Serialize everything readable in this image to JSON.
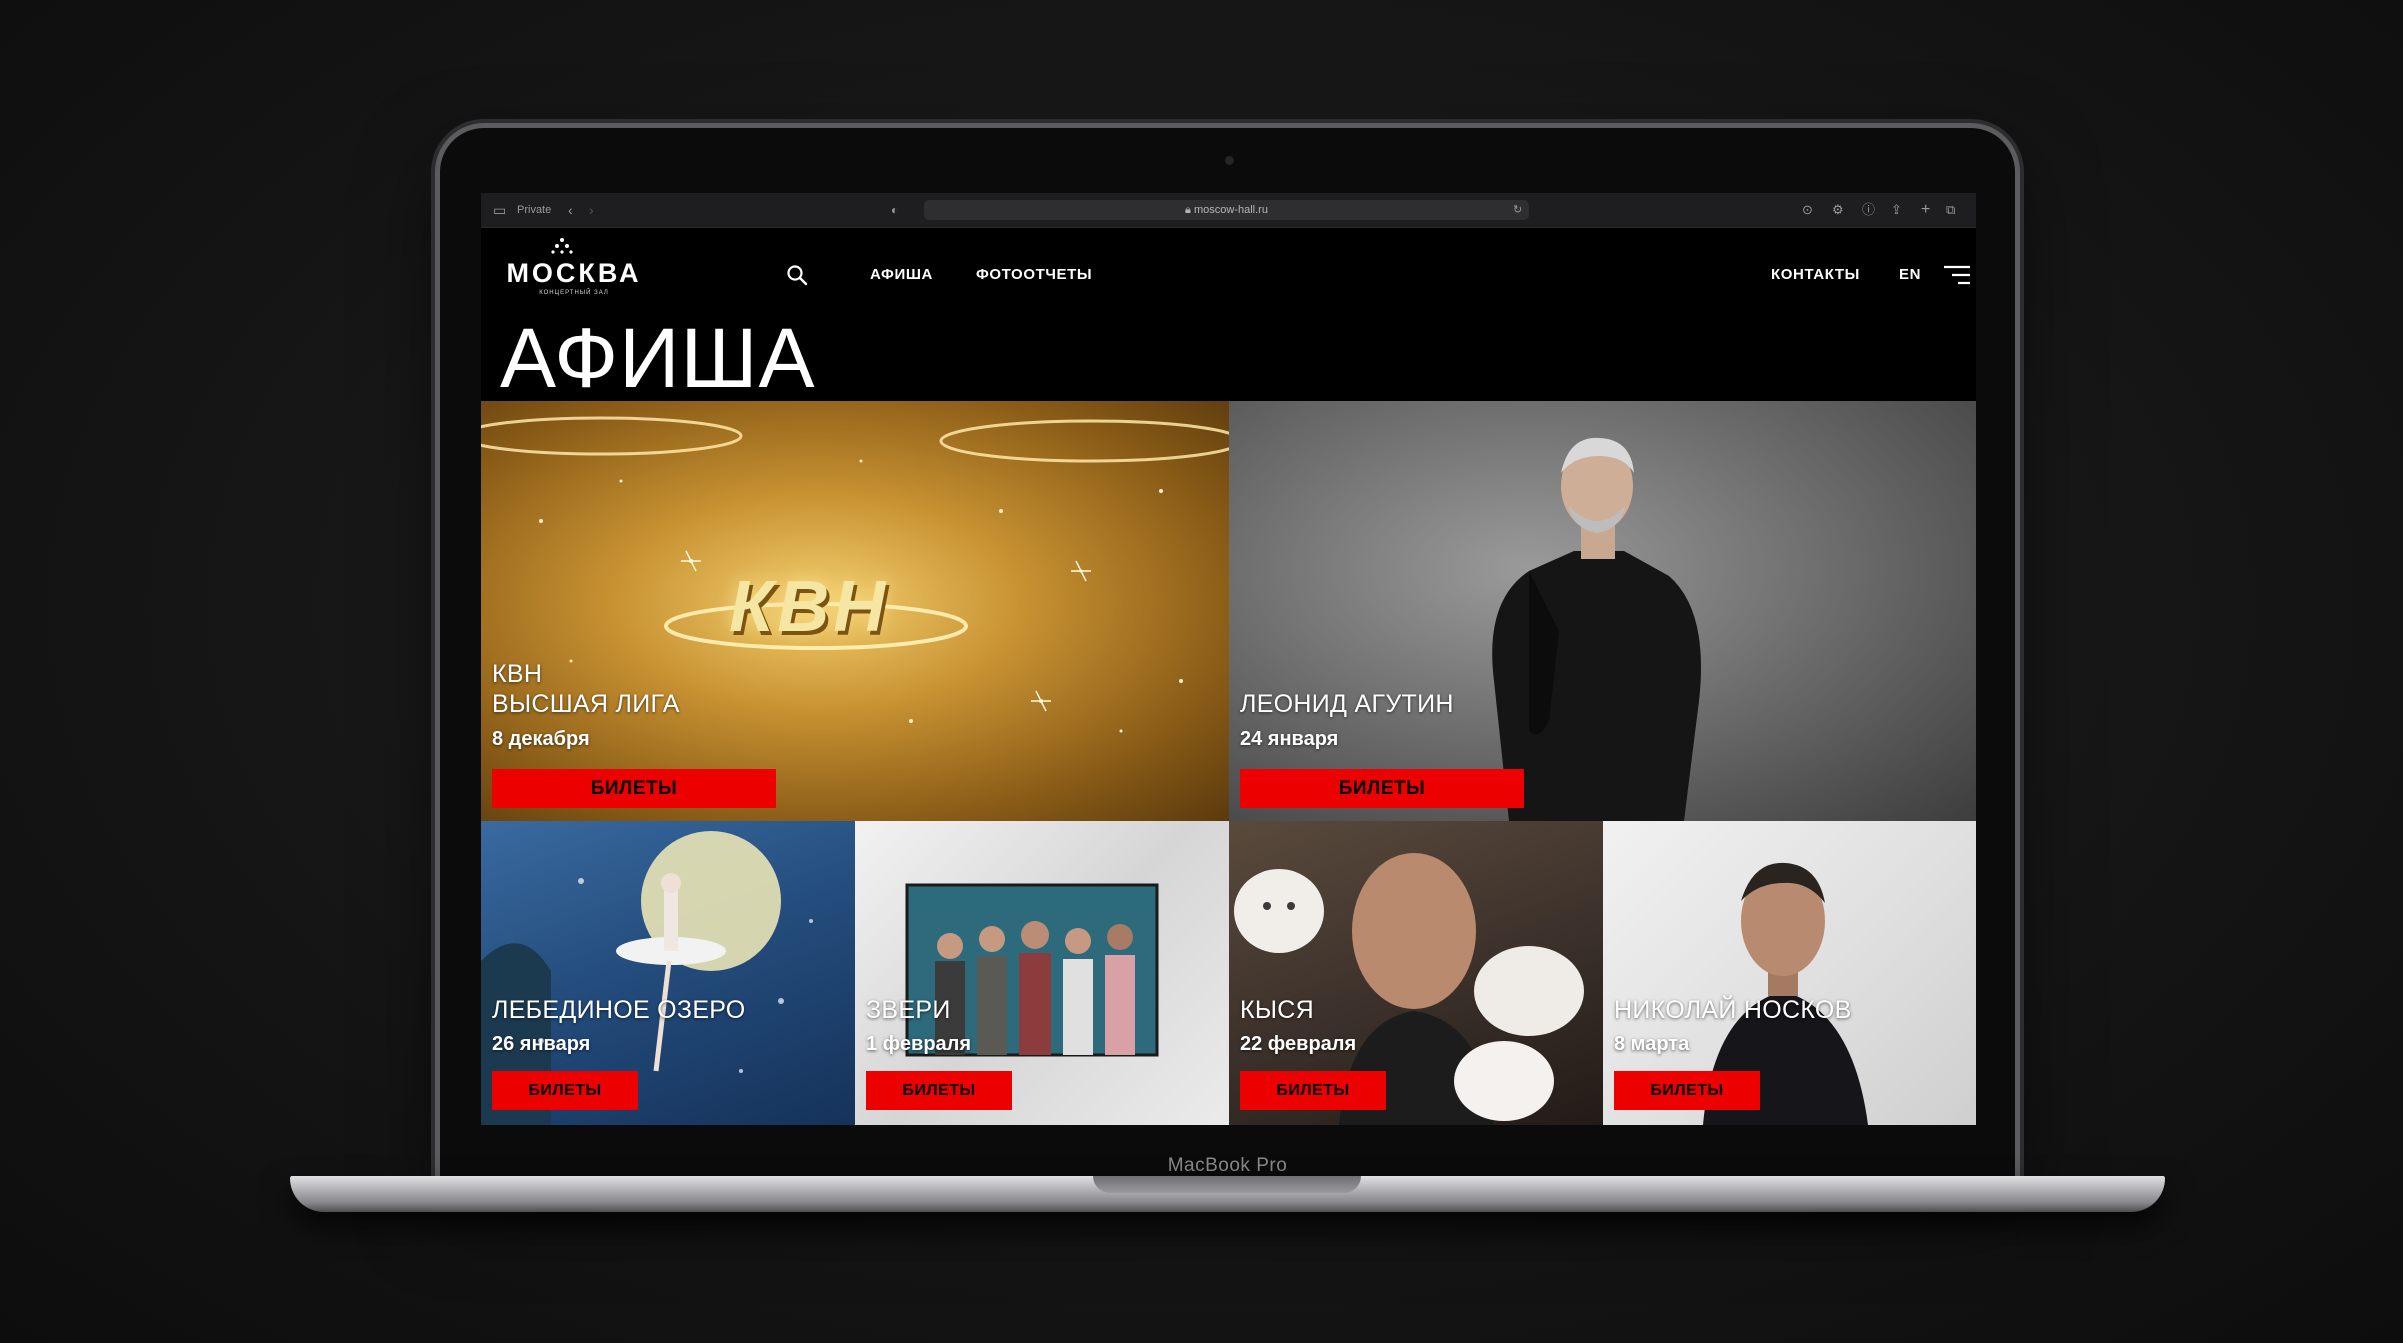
{
  "browser": {
    "private_label": "Private",
    "url": "moscow-hall.ru"
  },
  "device": {
    "model": "MacBook Pro"
  },
  "site": {
    "logo": "МОСКВА",
    "logo_sub": "КОНЦЕРТНЫЙ ЗАЛ",
    "nav": {
      "afisha": "АФИША",
      "photo": "ФОТООТЧЕТЫ",
      "contacts": "КОНТАКТЫ",
      "lang": "EN"
    },
    "page_title": "АФИША"
  },
  "events": [
    {
      "title_line1": "КВН",
      "title_line2": "ВЫСШАЯ ЛИГА",
      "date": "8 декабря",
      "button": "БИЛЕТЫ",
      "art_text": "КВН"
    },
    {
      "title": "ЛЕОНИД АГУТИН",
      "date": "24 января",
      "button": "БИЛЕТЫ"
    },
    {
      "title": "ЛЕБЕДИНОЕ ОЗЕРО",
      "date": "26 января",
      "button": "БИЛЕТЫ"
    },
    {
      "title": "ЗВЕРИ",
      "date": "1 февраля",
      "button": "БИЛЕТЫ"
    },
    {
      "title": "КЫСЯ",
      "date": "22 февраля",
      "button": "БИЛЕТЫ"
    },
    {
      "title": "НИКОЛАЙ НОСКОВ",
      "date": "8 марта",
      "button": "БИЛЕТЫ"
    }
  ],
  "colors": {
    "accent": "#ec0000",
    "background": "#000000"
  }
}
